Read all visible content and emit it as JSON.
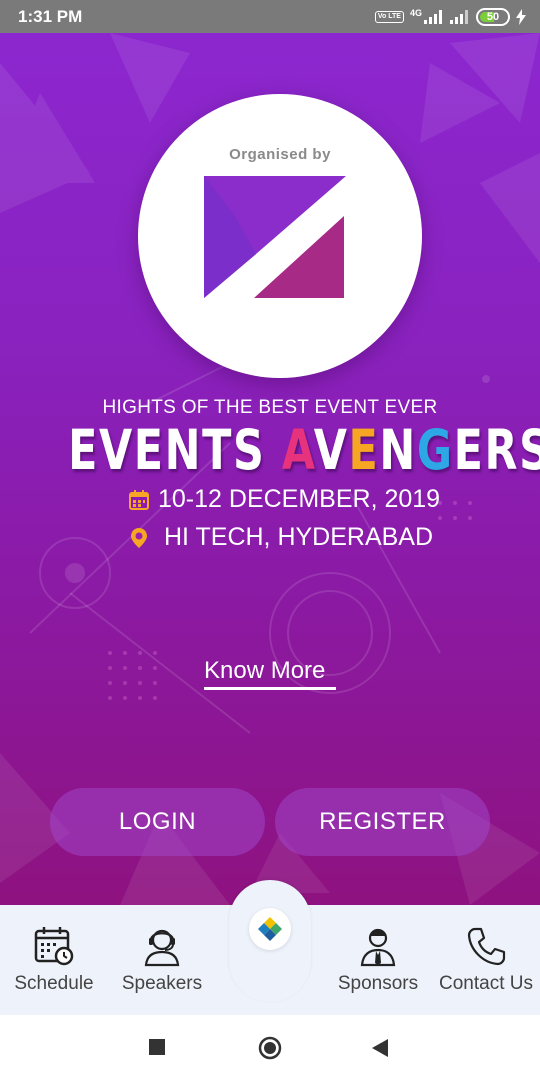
{
  "status_bar": {
    "time": "1:31 PM",
    "volte": "Vo LTE",
    "network": "4G",
    "battery": "50"
  },
  "logo": {
    "organised_by": "Organised by"
  },
  "event": {
    "tagline": "HIGHTS OF THE BEST EVENT EVER",
    "title_parts": [
      "EVENTS ",
      "A",
      "V",
      "E",
      "N",
      "G",
      "ERS"
    ],
    "title_colors": [
      "#ffffff",
      "#e7327d",
      "#ffffff",
      "#f6a623",
      "#ffffff",
      "#2ea7e6",
      "#ffffff"
    ],
    "date": "10-12 DECEMBER, 2019",
    "location": "HI TECH, HYDERABAD"
  },
  "actions": {
    "know_more": "Know More",
    "login": "LOGIN",
    "register": "REGISTER"
  },
  "bottom_nav": {
    "items": [
      {
        "label": "Schedule",
        "icon": "calendar-clock-icon"
      },
      {
        "label": "Speakers",
        "icon": "headset-person-icon"
      },
      {
        "label": "Sponsors",
        "icon": "person-tie-icon"
      },
      {
        "label": "Contact Us",
        "icon": "phone-icon"
      }
    ]
  },
  "colors": {
    "hero_top": "#8c27cf",
    "hero_bottom": "#8e127f",
    "logo_purple": "#8a2dcb",
    "logo_magenta": "#a62a86",
    "accent_orange": "#f6a623"
  }
}
